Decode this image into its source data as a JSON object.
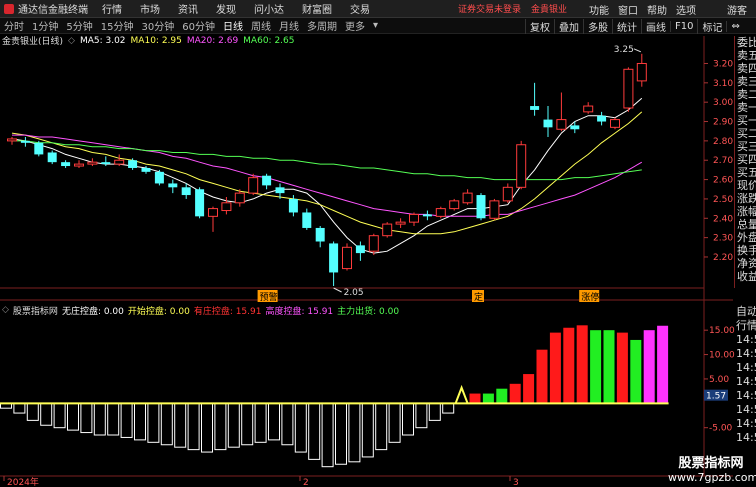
{
  "menubar": {
    "app_title": "通达信金融终端",
    "items": [
      "行情",
      "市场",
      "资讯",
      "发现",
      "问小达",
      "财富圈",
      "交易"
    ],
    "promo": "证券交易未登录",
    "promo_account": "金貴银业",
    "right_items": [
      "功能",
      "窗口",
      "帮助",
      "选项",
      "游客"
    ]
  },
  "periods": {
    "items": [
      "分时",
      "1分钟",
      "5分钟",
      "15分钟",
      "30分钟",
      "60分钟",
      "日线",
      "周线",
      "月线",
      "多周期",
      "更多"
    ],
    "active": "日线",
    "right_buttons": [
      "复权",
      "叠加",
      "多股",
      "统计",
      "画线",
      "F10",
      "标记"
    ]
  },
  "info": {
    "title": "金贵银业(日线)",
    "ma5": "MA5: 3.02",
    "ma10": "MA10: 2.95",
    "ma20": "MA20: 2.69",
    "ma60": "MA60: 2.65",
    "colors": {
      "ma5": "#ffffff",
      "ma10": "#ffff55",
      "ma20": "#ff55ff",
      "ma60": "#55ff55"
    }
  },
  "side_panel": [
    "委比",
    "卖五",
    "卖四",
    "卖三",
    "卖二",
    "卖一",
    "买一",
    "买二",
    "买三",
    "买四",
    "买五",
    "现价",
    "涨跌",
    "涨幅",
    "总量",
    "外盘",
    "换手",
    "净资",
    "收益"
  ],
  "side_lower": [
    "自动",
    "行情",
    "14:5",
    "14:5",
    "14:5",
    "14:5",
    "14:5",
    "14:5",
    "14:5",
    "14:5"
  ],
  "price_axis": [
    {
      "label": "3.20",
      "value": 3.2
    },
    {
      "label": "3.10",
      "value": 3.1
    },
    {
      "label": "3.00",
      "value": 3.0
    },
    {
      "label": "2.90",
      "value": 2.9
    },
    {
      "label": "2.80",
      "value": 2.8
    },
    {
      "label": "2.70",
      "value": 2.7
    },
    {
      "label": "2.60",
      "value": 2.6
    },
    {
      "label": "2.50",
      "value": 2.5
    },
    {
      "label": "2.40",
      "value": 2.4
    },
    {
      "label": "2.30",
      "value": 2.3
    },
    {
      "label": "2.20",
      "value": 2.2
    }
  ],
  "price_annotations": {
    "high": "3.25",
    "low": "2.05"
  },
  "event_tags": [
    {
      "label": "预警",
      "bar": 19
    },
    {
      "label": "定",
      "bar": 35
    },
    {
      "label": "涨停",
      "bar": 43
    }
  ],
  "indicator": {
    "title": "股票指标网",
    "fields": [
      {
        "text": "无庄控盘: 0.00",
        "color": "#ffffff"
      },
      {
        "text": "开始控盘: 0.00",
        "color": "#ffff55"
      },
      {
        "text": "有庄控盘: 15.91",
        "color": "#ff3333"
      },
      {
        "text": "高度控盘: 15.91",
        "color": "#ff55ff"
      },
      {
        "text": "主力出货: 0.00",
        "color": "#55ff55"
      }
    ],
    "axis": [
      {
        "label": "15.00",
        "value": 15
      },
      {
        "label": "10.00",
        "value": 10
      },
      {
        "label": "5.00",
        "value": 5
      },
      {
        "label": "1.57",
        "value": 1.57
      },
      {
        "label": "-5.00",
        "value": -5
      }
    ]
  },
  "date_axis": [
    "2024年",
    "2",
    "3"
  ],
  "watermark": {
    "line1": "股票指标网",
    "line2": "www.7gpzb.com"
  },
  "chart_data": {
    "type": "candlestick",
    "candles": [
      {
        "o": 2.8,
        "c": 2.81,
        "h": 2.82,
        "l": 2.78
      },
      {
        "o": 2.8,
        "c": 2.79,
        "h": 2.82,
        "l": 2.77
      },
      {
        "o": 2.79,
        "c": 2.73,
        "h": 2.8,
        "l": 2.72
      },
      {
        "o": 2.74,
        "c": 2.69,
        "h": 2.75,
        "l": 2.68
      },
      {
        "o": 2.69,
        "c": 2.67,
        "h": 2.7,
        "l": 2.66
      },
      {
        "o": 2.67,
        "c": 2.68,
        "h": 2.7,
        "l": 2.66
      },
      {
        "o": 2.68,
        "c": 2.69,
        "h": 2.71,
        "l": 2.67
      },
      {
        "o": 2.69,
        "c": 2.68,
        "h": 2.72,
        "l": 2.67
      },
      {
        "o": 2.68,
        "c": 2.7,
        "h": 2.73,
        "l": 2.67
      },
      {
        "o": 2.7,
        "c": 2.66,
        "h": 2.71,
        "l": 2.65
      },
      {
        "o": 2.66,
        "c": 2.64,
        "h": 2.67,
        "l": 2.63
      },
      {
        "o": 2.64,
        "c": 2.58,
        "h": 2.65,
        "l": 2.57
      },
      {
        "o": 2.58,
        "c": 2.56,
        "h": 2.6,
        "l": 2.53
      },
      {
        "o": 2.56,
        "c": 2.52,
        "h": 2.58,
        "l": 2.5
      },
      {
        "o": 2.55,
        "c": 2.41,
        "h": 2.56,
        "l": 2.4
      },
      {
        "o": 2.41,
        "c": 2.45,
        "h": 2.46,
        "l": 2.33
      },
      {
        "o": 2.44,
        "c": 2.48,
        "h": 2.51,
        "l": 2.42
      },
      {
        "o": 2.48,
        "c": 2.53,
        "h": 2.55,
        "l": 2.46
      },
      {
        "o": 2.53,
        "c": 2.61,
        "h": 2.63,
        "l": 2.52
      },
      {
        "o": 2.62,
        "c": 2.57,
        "h": 2.63,
        "l": 2.55
      },
      {
        "o": 2.56,
        "c": 2.53,
        "h": 2.58,
        "l": 2.5
      },
      {
        "o": 2.5,
        "c": 2.43,
        "h": 2.52,
        "l": 2.41
      },
      {
        "o": 2.43,
        "c": 2.35,
        "h": 2.45,
        "l": 2.34
      },
      {
        "o": 2.35,
        "c": 2.28,
        "h": 2.36,
        "l": 2.25
      },
      {
        "o": 2.27,
        "c": 2.12,
        "h": 2.28,
        "l": 2.05
      },
      {
        "o": 2.14,
        "c": 2.25,
        "h": 2.27,
        "l": 2.13
      },
      {
        "o": 2.26,
        "c": 2.22,
        "h": 2.28,
        "l": 2.18
      },
      {
        "o": 2.23,
        "c": 2.31,
        "h": 2.32,
        "l": 2.21
      },
      {
        "o": 2.31,
        "c": 2.37,
        "h": 2.38,
        "l": 2.3
      },
      {
        "o": 2.37,
        "c": 2.38,
        "h": 2.4,
        "l": 2.35
      },
      {
        "o": 2.38,
        "c": 2.42,
        "h": 2.43,
        "l": 2.36
      },
      {
        "o": 2.42,
        "c": 2.41,
        "h": 2.44,
        "l": 2.39
      },
      {
        "o": 2.41,
        "c": 2.45,
        "h": 2.46,
        "l": 2.4
      },
      {
        "o": 2.45,
        "c": 2.49,
        "h": 2.5,
        "l": 2.44
      },
      {
        "o": 2.48,
        "c": 2.53,
        "h": 2.55,
        "l": 2.47
      },
      {
        "o": 2.52,
        "c": 2.4,
        "h": 2.53,
        "l": 2.39
      },
      {
        "o": 2.4,
        "c": 2.49,
        "h": 2.5,
        "l": 2.39
      },
      {
        "o": 2.49,
        "c": 2.56,
        "h": 2.58,
        "l": 2.48
      },
      {
        "o": 2.56,
        "c": 2.78,
        "h": 2.8,
        "l": 2.55
      },
      {
        "o": 2.98,
        "c": 2.96,
        "h": 3.1,
        "l": 2.93
      },
      {
        "o": 2.91,
        "c": 2.87,
        "h": 2.98,
        "l": 2.82
      },
      {
        "o": 2.86,
        "c": 2.91,
        "h": 3.05,
        "l": 2.85
      },
      {
        "o": 2.88,
        "c": 2.86,
        "h": 2.9,
        "l": 2.84
      },
      {
        "o": 2.95,
        "c": 2.98,
        "h": 3.0,
        "l": 2.94
      },
      {
        "o": 2.93,
        "c": 2.9,
        "h": 2.95,
        "l": 2.88
      },
      {
        "o": 2.87,
        "c": 2.91,
        "h": 2.92,
        "l": 2.86
      },
      {
        "o": 2.97,
        "c": 3.17,
        "h": 3.18,
        "l": 2.95
      },
      {
        "o": 3.11,
        "c": 3.2,
        "h": 3.25,
        "l": 3.08
      }
    ],
    "ma": [
      {
        "name": "MA5",
        "values": [
          2.81,
          2.8,
          2.78,
          2.76,
          2.73,
          2.71,
          2.69,
          2.68,
          2.68,
          2.67,
          2.66,
          2.64,
          2.61,
          2.58,
          2.54,
          2.51,
          2.49,
          2.48,
          2.5,
          2.53,
          2.55,
          2.55,
          2.53,
          2.47,
          2.38,
          2.3,
          2.24,
          2.22,
          2.23,
          2.27,
          2.31,
          2.36,
          2.39,
          2.42,
          2.45,
          2.45,
          2.46,
          2.47,
          2.57,
          2.65,
          2.75,
          2.84,
          2.9,
          2.93,
          2.93,
          2.92,
          2.96,
          3.02
        ]
      },
      {
        "name": "MA10",
        "values": [
          2.84,
          2.83,
          2.81,
          2.79,
          2.77,
          2.76,
          2.74,
          2.73,
          2.71,
          2.7,
          2.68,
          2.67,
          2.65,
          2.63,
          2.6,
          2.58,
          2.56,
          2.54,
          2.53,
          2.52,
          2.51,
          2.5,
          2.49,
          2.47,
          2.44,
          2.41,
          2.38,
          2.36,
          2.34,
          2.33,
          2.32,
          2.32,
          2.32,
          2.33,
          2.35,
          2.37,
          2.39,
          2.41,
          2.45,
          2.5,
          2.56,
          2.62,
          2.68,
          2.73,
          2.79,
          2.84,
          2.89,
          2.95
        ]
      },
      {
        "name": "MA20",
        "values": [
          2.83,
          2.83,
          2.82,
          2.82,
          2.81,
          2.8,
          2.79,
          2.78,
          2.77,
          2.76,
          2.75,
          2.74,
          2.72,
          2.71,
          2.69,
          2.67,
          2.66,
          2.64,
          2.62,
          2.61,
          2.59,
          2.57,
          2.55,
          2.53,
          2.51,
          2.49,
          2.47,
          2.45,
          2.44,
          2.43,
          2.42,
          2.42,
          2.41,
          2.41,
          2.41,
          2.41,
          2.42,
          2.42,
          2.44,
          2.46,
          2.48,
          2.5,
          2.52,
          2.55,
          2.58,
          2.61,
          2.65,
          2.69
        ]
      },
      {
        "name": "MA60",
        "values": [
          2.8,
          2.8,
          2.79,
          2.79,
          2.78,
          2.78,
          2.77,
          2.77,
          2.76,
          2.76,
          2.75,
          2.75,
          2.74,
          2.74,
          2.73,
          2.73,
          2.72,
          2.72,
          2.71,
          2.71,
          2.7,
          2.7,
          2.69,
          2.68,
          2.68,
          2.67,
          2.66,
          2.66,
          2.65,
          2.64,
          2.63,
          2.63,
          2.62,
          2.62,
          2.61,
          2.61,
          2.6,
          2.6,
          2.6,
          2.6,
          2.6,
          2.6,
          2.61,
          2.61,
          2.62,
          2.63,
          2.64,
          2.65
        ]
      }
    ],
    "indicator_bars": [
      -1.0,
      -2.0,
      -3.5,
      -4.5,
      -5.0,
      -5.5,
      -6.0,
      -6.5,
      -6.5,
      -7.0,
      -7.5,
      -8.0,
      -8.5,
      -9.0,
      -9.5,
      -10.0,
      -9.5,
      -9.0,
      -8.5,
      -8.0,
      -7.5,
      -8.5,
      -10.0,
      -11.5,
      -13.0,
      -12.5,
      -12.0,
      -11.0,
      -9.5,
      -8.0,
      -6.5,
      -5.0,
      -3.5,
      -2.0,
      0,
      2.0,
      2.0,
      3.0,
      4.0,
      6.0,
      11.0,
      14.5,
      15.5,
      16.0,
      15.0,
      15.0,
      14.5,
      13.0,
      15.0,
      15.91
    ],
    "indicator_colors": [
      "w",
      "w",
      "w",
      "w",
      "w",
      "w",
      "w",
      "w",
      "w",
      "w",
      "w",
      "w",
      "w",
      "w",
      "w",
      "w",
      "w",
      "w",
      "w",
      "w",
      "w",
      "w",
      "w",
      "w",
      "w",
      "w",
      "w",
      "w",
      "w",
      "w",
      "w",
      "w",
      "w",
      "w",
      "y",
      "r",
      "g",
      "g",
      "r",
      "r",
      "r",
      "r",
      "r",
      "r",
      "g",
      "g",
      "r",
      "g",
      "m",
      "m"
    ]
  }
}
